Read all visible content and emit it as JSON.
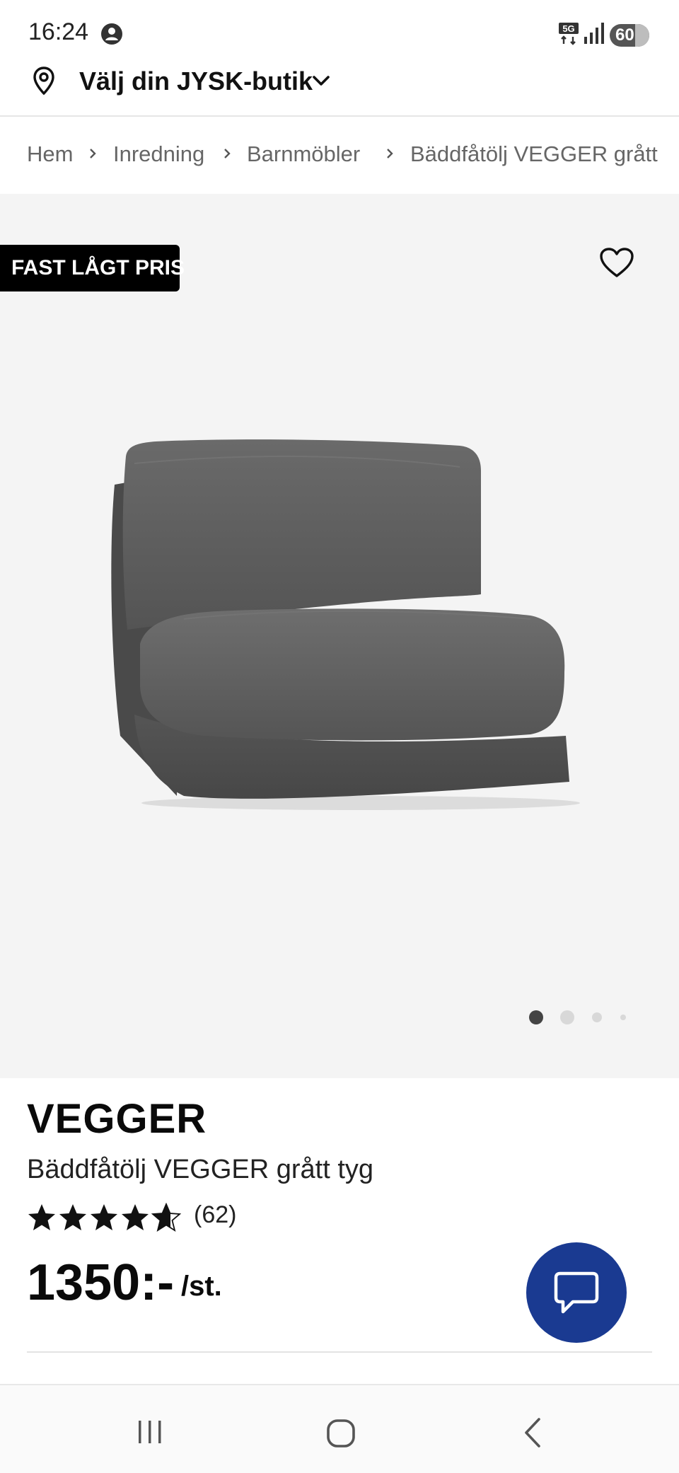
{
  "status_bar": {
    "time": "16:24",
    "network": "5G",
    "battery": "60"
  },
  "store_selector": {
    "label": "Välj din JYSK-butik"
  },
  "breadcrumb": [
    {
      "label": "Hem"
    },
    {
      "label": "Inredning"
    },
    {
      "label": "Barnmöbler"
    },
    {
      "label": "Bäddfåtölj VEGGER grått"
    }
  ],
  "gallery": {
    "badge": "FAST LÅGT PRIS",
    "image_count": 4,
    "active_index": 0,
    "image_icon": "grey-fabric-sofa-bed-chair"
  },
  "product": {
    "brand": "VEGGER",
    "name": "Bäddfåtölj VEGGER grått tyg",
    "rating": 4.7,
    "review_count": "(62)",
    "price": "1350:-",
    "unit": "/st."
  },
  "colors": {
    "accent": "#1a3a91",
    "badge_bg": "#000000",
    "gallery_bg": "#f4f4f4"
  },
  "icons": {
    "status_user": "account-circle-icon",
    "store": "location-pin-icon",
    "wishlist": "heart-icon",
    "chat": "chat-bubble-icon",
    "nav": [
      "recents-icon",
      "home-icon",
      "back-icon"
    ]
  }
}
